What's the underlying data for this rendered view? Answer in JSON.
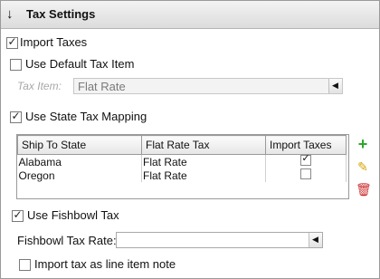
{
  "header": {
    "title": "Tax Settings",
    "collapse_icon": "arrow-down-icon"
  },
  "import_taxes": {
    "label": "Import Taxes",
    "checked": true
  },
  "default_tax_item": {
    "label": "Use Default Tax Item",
    "checked": false
  },
  "tax_item": {
    "label": "Tax Item:",
    "value": "Flat Rate"
  },
  "state_tax_mapping": {
    "label": "Use State Tax Mapping",
    "checked": true
  },
  "grid": {
    "headers": [
      "Ship To State",
      "Flat Rate Tax",
      "Import Taxes"
    ],
    "rows": [
      {
        "state": "Alabama",
        "tax": "Flat Rate",
        "import": true
      },
      {
        "state": "Oregon",
        "tax": "Flat Rate",
        "import": false
      }
    ]
  },
  "grid_actions": {
    "add_icon": "plus-icon",
    "edit_icon": "pencil-icon",
    "delete_icon": "trash-icon"
  },
  "fishbowl_tax": {
    "label": "Use Fishbowl Tax",
    "checked": true
  },
  "fishbowl_rate": {
    "label": "Fishbowl Tax Rate:",
    "value": ""
  },
  "line_item_note": {
    "label": "Import tax as line item note",
    "checked": false
  },
  "colors": {
    "add": "#2fa52f",
    "edit": "#d4a400",
    "delete": "#cc2a2a"
  }
}
